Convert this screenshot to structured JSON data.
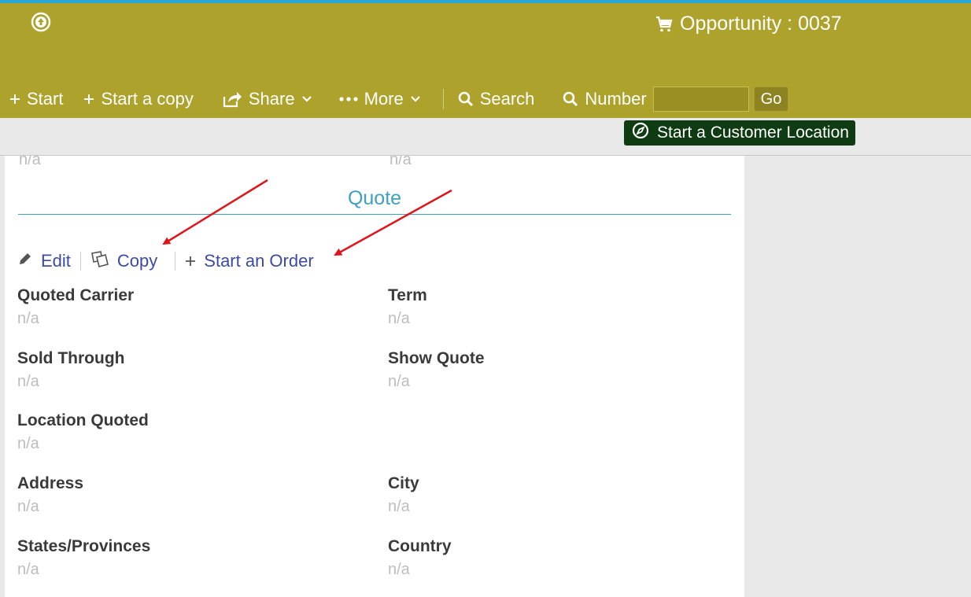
{
  "header": {
    "title": "Opportunity : 0037",
    "bg_color": "#ada22b"
  },
  "toolbar": {
    "start": "Start",
    "start_copy": "Start a copy",
    "share": "Share",
    "more": "More",
    "search": "Search",
    "number_label": "Number",
    "number_value": "",
    "go": "Go"
  },
  "subbar": {
    "start_location": "Start a Customer Location",
    "button_color": "#0f3b12"
  },
  "top_values": [
    "n/a",
    "n/a"
  ],
  "quote": {
    "title": "Quote",
    "accent_color": "#3fa0bf",
    "actions": {
      "edit": "Edit",
      "copy": "Copy",
      "start_order": "Start an Order"
    },
    "fields": {
      "quoted_carrier": {
        "label": "Quoted Carrier",
        "value": "n/a"
      },
      "term": {
        "label": "Term",
        "value": "n/a"
      },
      "sold_through": {
        "label": "Sold Through",
        "value": "n/a"
      },
      "show_quote": {
        "label": "Show Quote",
        "value": "n/a"
      },
      "location_quoted": {
        "label": "Location Quoted",
        "value": "n/a"
      },
      "address": {
        "label": "Address",
        "value": "n/a"
      },
      "city": {
        "label": "City",
        "value": "n/a"
      },
      "states": {
        "label": "States/Provinces",
        "value": "n/a"
      },
      "country": {
        "label": "Country",
        "value": "n/a"
      }
    }
  },
  "icons": [
    "arrow-up-circle-icon",
    "cart-icon",
    "plus-icon",
    "share-icon",
    "dots-icon",
    "chevron-down-icon",
    "search-icon",
    "compass-icon",
    "pencil-icon",
    "copy-icon"
  ],
  "annotation_color": "#e0141b"
}
